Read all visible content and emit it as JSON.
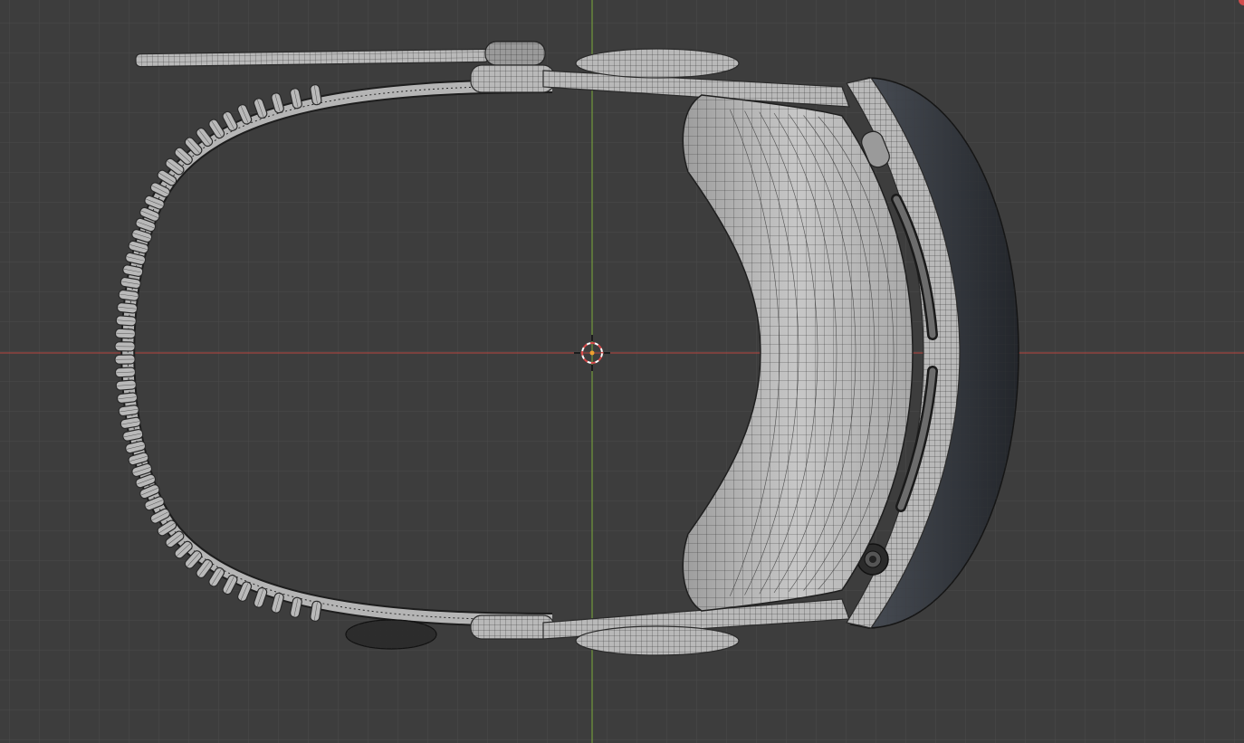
{
  "viewport": {
    "background_color": "#3d3d3d",
    "grid_color": "#4a4a4a",
    "x_axis_color": "#b8453f",
    "y_axis_color": "#7bab3c",
    "object_name": "headset-wireframe",
    "view": "top-orthographic"
  },
  "icons": {
    "origin": "3d-cursor-icon"
  }
}
